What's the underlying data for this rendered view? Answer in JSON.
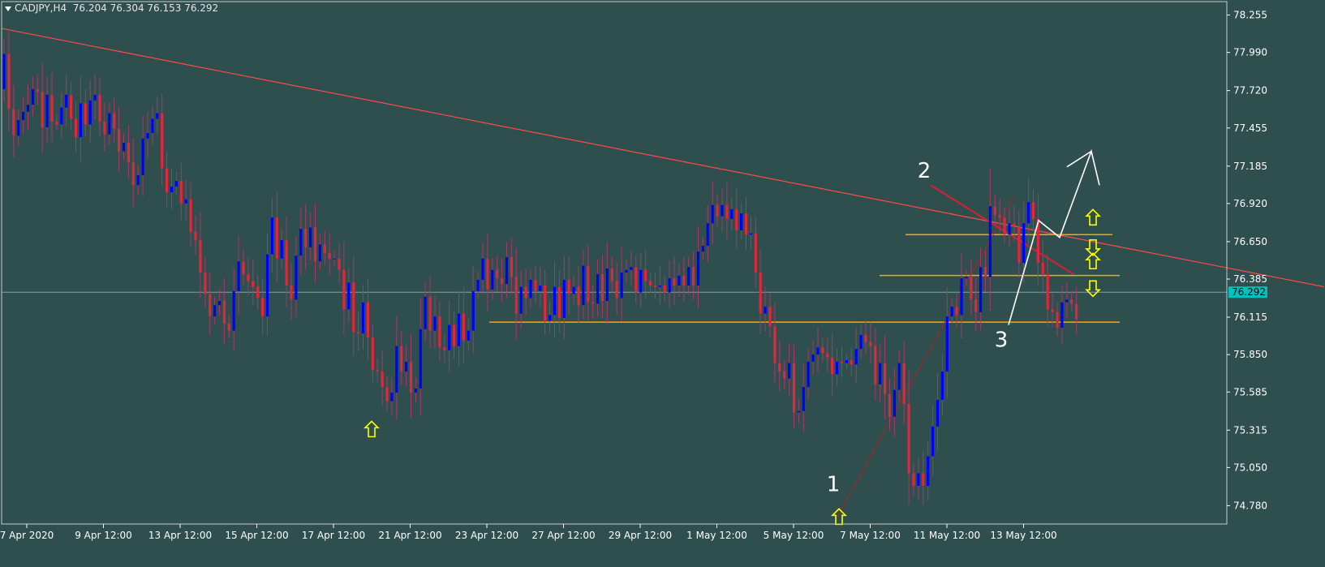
{
  "header": {
    "symbol": "CADJPY,H4",
    "ohlc": "76.204 76.304 76.153 76.292"
  },
  "colors": {
    "background": "#2f4f4f",
    "bull": "#0000ff",
    "bear": "#e3263b",
    "axis_text": "#ffffff",
    "trendline": "#ff4a4a",
    "levels": "#ffa500",
    "arrows": "#ffff00",
    "annotation": "#ffffff",
    "bid_line": "#7fa3a3",
    "bid_label_bg": "#00c0c0"
  },
  "chart_data": {
    "type": "candlestick",
    "symbol": "CADJPY",
    "timeframe": "H4",
    "ylim": [
      74.65,
      78.35
    ],
    "y_ticks": [
      78.255,
      77.99,
      77.72,
      77.455,
      77.185,
      76.92,
      76.65,
      76.385,
      76.115,
      75.85,
      75.585,
      75.315,
      75.05,
      74.78
    ],
    "y_tick_labels": [
      "78.255",
      "77.990",
      "77.720",
      "77.455",
      "77.185",
      "76.920",
      "76.650",
      "76.385",
      "76.115",
      "75.850",
      "75.585",
      "75.315",
      "75.050",
      "74.780"
    ],
    "x_labels": [
      "7 Apr 2020",
      "9 Apr 12:00",
      "13 Apr 12:00",
      "15 Apr 12:00",
      "17 Apr 12:00",
      "21 Apr 12:00",
      "23 Apr 12:00",
      "27 Apr 12:00",
      "29 Apr 12:00",
      "1 May 12:00",
      "5 May 12:00",
      "7 May 12:00",
      "11 May 12:00",
      "13 May 12:00"
    ],
    "current_price": 76.292,
    "current_price_label": "76.292",
    "close": [
      77.98,
      77.59,
      77.4,
      77.51,
      77.57,
      77.62,
      77.73,
      77.71,
      77.46,
      77.69,
      77.5,
      77.48,
      77.6,
      77.69,
      77.52,
      77.39,
      77.63,
      77.48,
      77.65,
      77.69,
      77.5,
      77.41,
      77.56,
      77.45,
      77.29,
      77.35,
      77.21,
      77.05,
      77.12,
      77.38,
      77.42,
      77.52,
      77.56,
      77.17,
      77.0,
      77.04,
      77.08,
      76.92,
      76.95,
      76.72,
      76.66,
      76.43,
      76.28,
      76.12,
      76.2,
      76.23,
      76.07,
      76.02,
      76.3,
      76.51,
      76.42,
      76.37,
      76.33,
      76.25,
      76.12,
      76.56,
      76.82,
      76.53,
      76.66,
      76.34,
      76.24,
      76.55,
      76.74,
      76.61,
      76.75,
      76.51,
      76.63,
      76.57,
      76.53,
      76.53,
      76.45,
      76.17,
      76.36,
      76.01,
      76.0,
      76.22,
      75.97,
      75.74,
      75.73,
      75.62,
      75.52,
      75.58,
      75.91,
      75.73,
      75.8,
      75.58,
      75.61,
      76.03,
      76.26,
      76.02,
      76.12,
      75.9,
      75.88,
      76.06,
      75.91,
      76.14,
      75.95,
      76.02,
      76.3,
      76.38,
      76.53,
      76.31,
      76.45,
      76.39,
      76.35,
      76.54,
      76.4,
      76.14,
      76.33,
      76.25,
      76.38,
      76.3,
      76.34,
      76.09,
      76.13,
      76.33,
      76.11,
      76.38,
      76.28,
      76.33,
      76.2,
      76.48,
      76.22,
      76.21,
      76.42,
      76.23,
      76.46,
      76.37,
      76.25,
      76.43,
      76.45,
      76.47,
      76.29,
      76.45,
      76.37,
      76.34,
      76.33,
      76.34,
      76.29,
      76.39,
      76.34,
      76.41,
      76.34,
      76.47,
      76.34,
      76.58,
      76.62,
      76.78,
      76.91,
      76.83,
      76.91,
      76.81,
      76.88,
      76.73,
      76.85,
      76.7,
      76.71,
      76.43,
      76.14,
      76.19,
      76.05,
      75.79,
      75.73,
      75.68,
      75.79,
      75.44,
      75.45,
      75.62,
      75.8,
      75.85,
      75.9,
      75.86,
      75.83,
      75.71,
      75.8,
      75.79,
      75.81,
      75.78,
      75.89,
      75.99,
      75.94,
      75.91,
      75.64,
      75.79,
      75.57,
      75.41,
      75.6,
      75.79,
      75.5,
      75.01,
      74.92,
      75.01,
      74.92,
      75.13,
      75.34,
      75.53,
      75.73,
      76.12,
      76.19,
      76.13,
      76.39,
      76.4,
      76.24,
      76.15,
      76.47,
      76.4,
      76.9,
      76.84,
      76.82,
      76.7,
      76.78,
      76.76,
      76.5,
      76.78,
      76.93,
      76.81,
      76.5,
      76.42,
      76.17,
      76.15,
      76.04,
      76.22,
      76.24,
      76.21,
      76.1
    ]
  },
  "annotations": {
    "wave_labels": [
      {
        "text": "1",
        "price": 74.93
      },
      {
        "text": "2",
        "price": 77.15
      },
      {
        "text": "3",
        "price": 75.95
      }
    ],
    "horizontal_levels": [
      76.7,
      76.41,
      76.08
    ],
    "long_trendline": {
      "from_price": 78.16,
      "to_price": 76.33
    },
    "projection_prices": [
      76.06,
      76.8,
      76.68,
      77.29,
      77.05
    ]
  }
}
